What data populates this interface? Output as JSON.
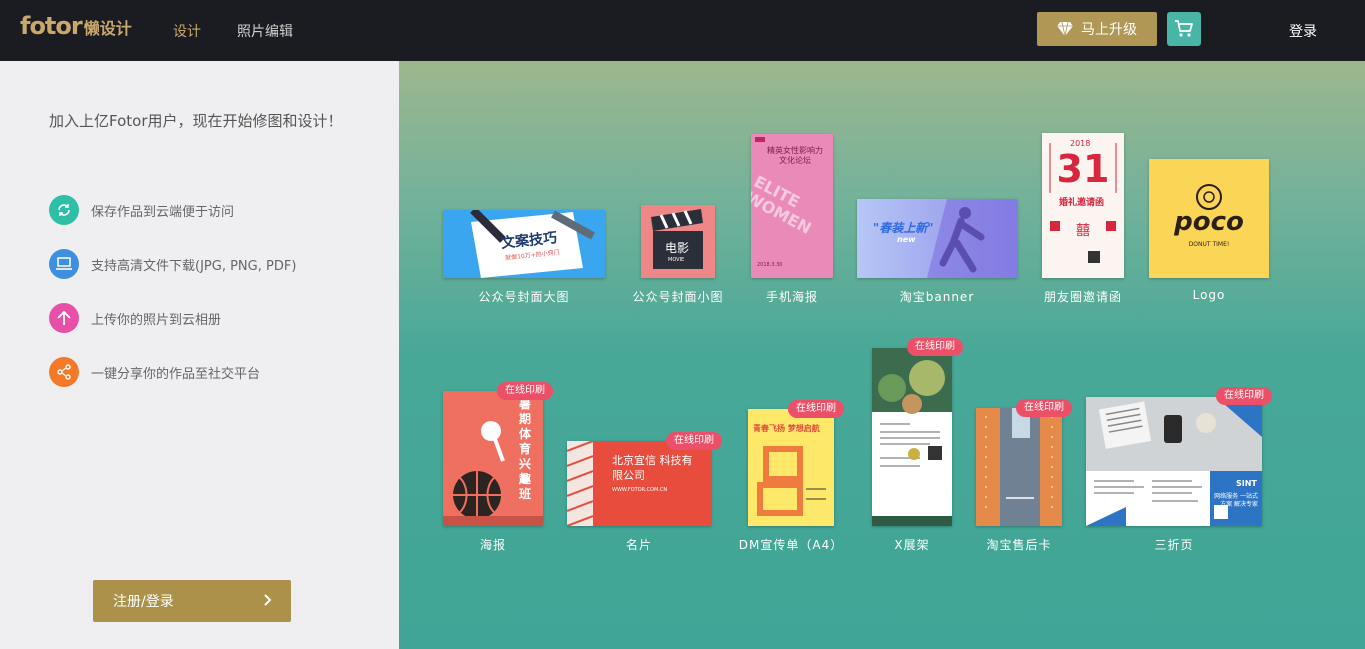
{
  "header": {
    "logo_main": "fotor",
    "logo_sub": "懒设计",
    "nav": {
      "design": "设计",
      "photo_edit": "照片编辑"
    },
    "upgrade_label": "马上升级",
    "login_label": "登录"
  },
  "left_panel": {
    "intro": "加入上亿Fotor用户，现在开始修图和设计！",
    "features": [
      {
        "label": "保存作品到云端便于访问",
        "icon": "cloud-sync-icon",
        "color": "#2fbfa6"
      },
      {
        "label": "支持高清文件下载(JPG, PNG, PDF)",
        "icon": "monitor-icon",
        "color": "#3f8fe0"
      },
      {
        "label": "上传你的照片到云相册",
        "icon": "upload-arrow-icon",
        "color": "#e84fa9"
      },
      {
        "label": "一键分享你的作品至社交平台",
        "icon": "share-icon",
        "color": "#f47a2a"
      }
    ],
    "register_label": "注册/登录"
  },
  "badge_label": "在线印刷",
  "templates_row1": [
    {
      "label": "公众号封面大图",
      "thumb_text": "文案技巧",
      "thumb_sub": "就做10万+的小窍门"
    },
    {
      "label": "公众号封面小图",
      "thumb_text": "电影",
      "thumb_sub": "MOVIE"
    },
    {
      "label": "手机海报",
      "thumb_text": "精英女性影响力 文化论坛",
      "thumb_sub": "ELITE WOMEN",
      "thumb_date": "2018.3.30"
    },
    {
      "label": "淘宝banner",
      "thumb_text": "\"春装上新\"",
      "thumb_sub": "new"
    },
    {
      "label": "朋友圈邀请函",
      "thumb_text": "31",
      "thumb_sub": "婚礼邀请函",
      "thumb_year": "2018"
    },
    {
      "label": "Logo",
      "thumb_text": "poco",
      "thumb_sub": "DONUT TIME!"
    }
  ],
  "templates_row2": [
    {
      "label": "海报",
      "thumb_text": "暑期体育兴趣班",
      "badge": true
    },
    {
      "label": "名片",
      "thumb_text": "北京宜信 科技有限公司",
      "thumb_sub": "WWW.FOTOR.COM.CN",
      "badge": true
    },
    {
      "label": "DM宣传单（A4）",
      "thumb_text": "青春飞扬 梦想启航",
      "badge": true
    },
    {
      "label": "X展架",
      "badge": true
    },
    {
      "label": "淘宝售后卡",
      "badge": true
    },
    {
      "label": "三折页",
      "thumb_text": "网络服务 一站式方案 解决专家",
      "thumb_sub": "SINT",
      "badge": true
    }
  ]
}
